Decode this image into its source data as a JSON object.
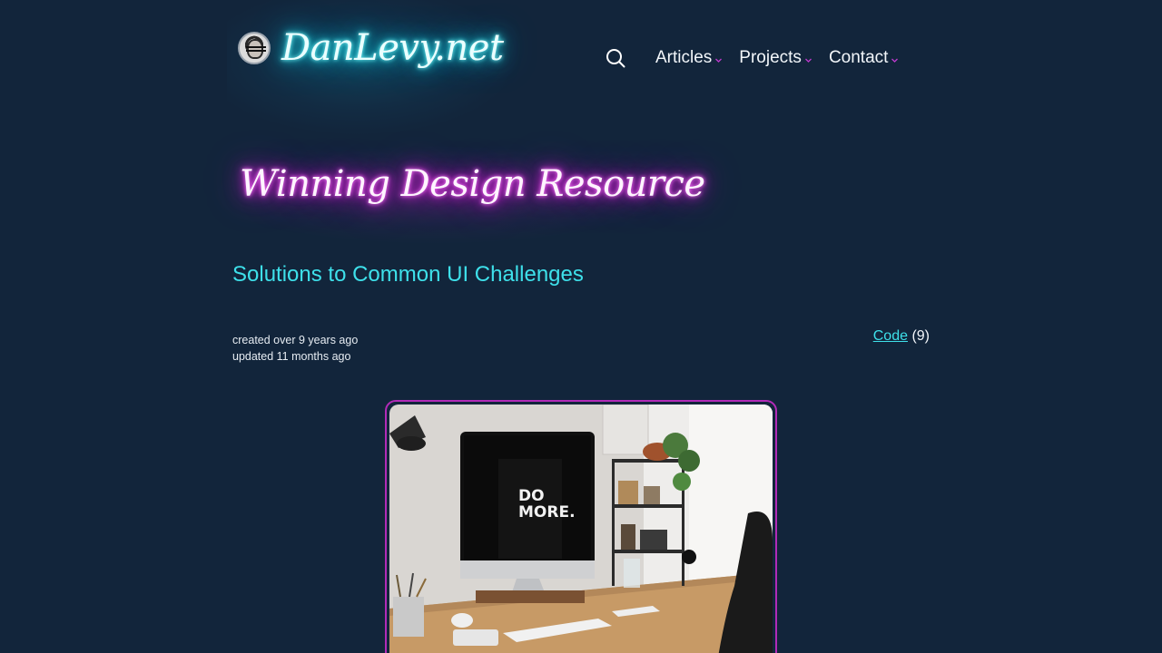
{
  "header": {
    "logo_text": "DanLevy.net",
    "avatar_alt": "avatar",
    "nav": [
      {
        "label": "Articles"
      },
      {
        "label": "Projects"
      },
      {
        "label": "Contact"
      }
    ]
  },
  "article": {
    "title": "Winning Design Resource",
    "subtitle": "Solutions to Common UI Challenges",
    "created": "created over 9 years ago",
    "updated": "updated 11 months ago",
    "category_label": "Code",
    "category_count": "(9)",
    "hero_image_text": "DO MORE."
  },
  "colors": {
    "background": "#12253b",
    "cyan_accent": "#3ee0ea",
    "magenta_accent": "#b22bb8",
    "nav_chevron": "#c23ad0"
  },
  "icons": {
    "search": "search-icon",
    "chevron": "chevron-down-icon"
  }
}
